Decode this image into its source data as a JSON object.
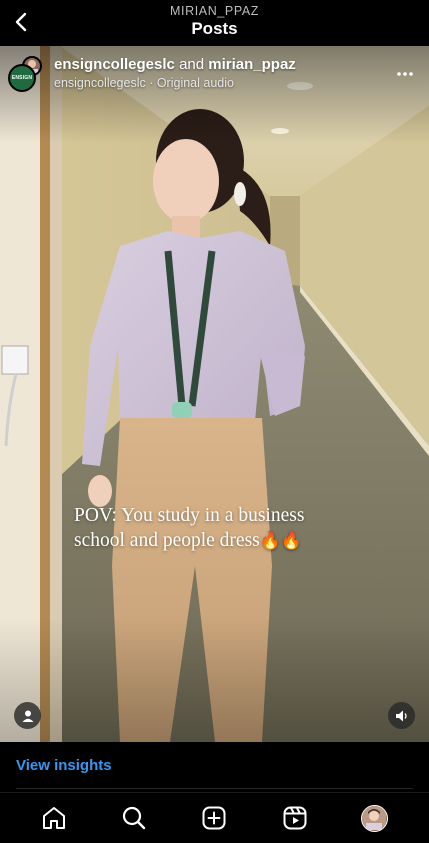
{
  "header": {
    "username": "MIRIAN_PPAZ",
    "title": "Posts"
  },
  "post": {
    "account_1": "ensigncollegeslc",
    "and": "and",
    "account_2": "mirian_ppaz",
    "audio_line": "ensigncollegeslc · Original audio",
    "avatar_label": "ENSIGN",
    "overlay_line_1": "POV: You study in a business",
    "overlay_line_2": "school and people dress",
    "overlay_emoji": "🔥🔥"
  },
  "insights": {
    "link_label": "View insights"
  },
  "nav": {
    "items": [
      "home",
      "search",
      "create",
      "reels",
      "profile"
    ]
  },
  "colors": {
    "background": "#000000",
    "link": "#3897f0",
    "avatar_green": "#1f6b3f"
  },
  "icons": [
    "back-arrow-icon",
    "more-options-icon",
    "tag-people-icon",
    "sound-icon",
    "home-icon",
    "search-icon",
    "create-icon",
    "reels-icon"
  ]
}
